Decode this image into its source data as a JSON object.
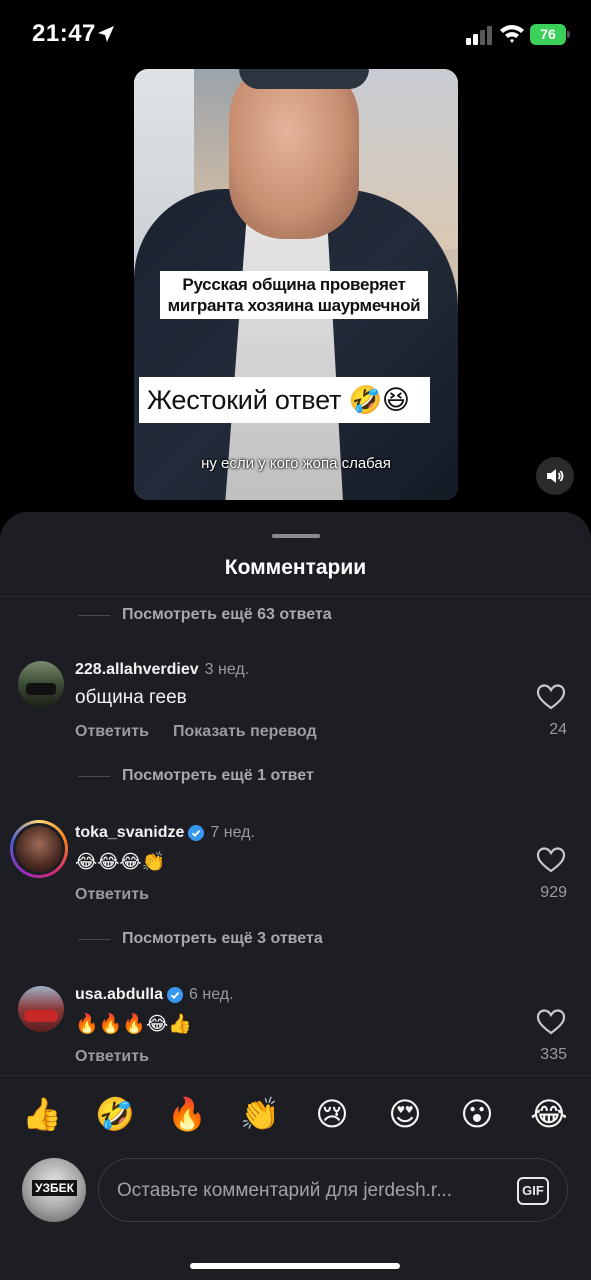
{
  "status_bar": {
    "time": "21:47",
    "battery": "76"
  },
  "video": {
    "caption_top": "Русская община проверяет мигранта хозяина шаурмечной",
    "caption_big": "Жестокий ответ 🤣😆",
    "subtitle": "ну если у кого жопа слабая"
  },
  "sheet": {
    "title": "Комментарии",
    "more_replies": [
      "Посмотреть ещё 63 ответа",
      "Посмотреть ещё 1 ответ",
      "Посмотреть ещё 3 ответа"
    ],
    "comments": [
      {
        "username": "228.allahverdiev",
        "age": "3 нед.",
        "text": "община геев",
        "reply_label": "Ответить",
        "translate_label": "Показать перевод",
        "likes": "24",
        "verified": false
      },
      {
        "username": "toka_svanidze",
        "age": "7 нед.",
        "text": "😂😂😂👏",
        "reply_label": "Ответить",
        "likes": "929",
        "verified": true
      },
      {
        "username": "usa.abdulla",
        "age": "6 нед.",
        "text": "🔥🔥🔥😂👍",
        "reply_label": "Ответить",
        "likes": "335",
        "verified": true
      }
    ]
  },
  "emoji_bar": [
    "👍",
    "🤣",
    "🔥",
    "👏",
    "😢",
    "😍",
    "😮",
    "😂"
  ],
  "input": {
    "placeholder": "Оставьте комментарий для jerdesh.r...",
    "gif_label": "GIF",
    "avatar_text": "УЗБЕК"
  },
  "colors": {
    "accent_verified": "#3897f0",
    "battery": "#3ad05a",
    "sheet_bg": "#1d1e23"
  }
}
